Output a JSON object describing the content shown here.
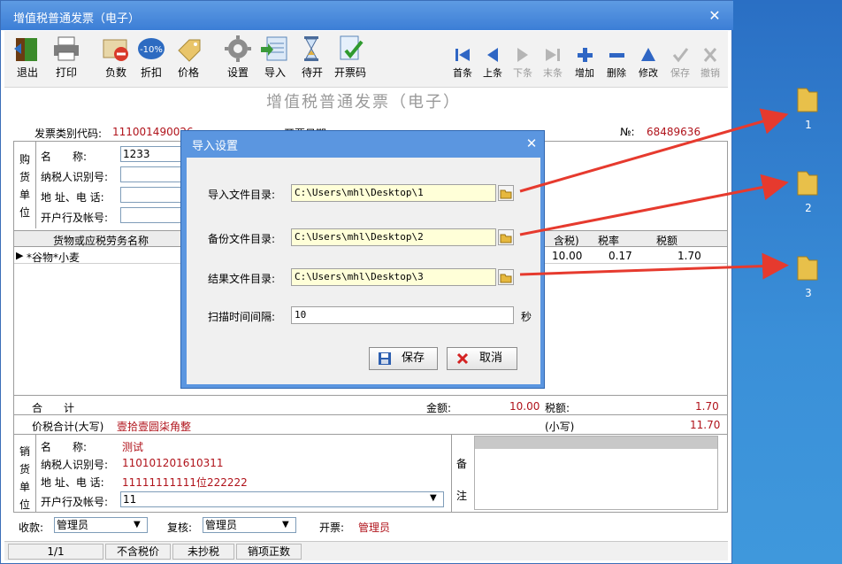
{
  "window": {
    "title": "增值税普通发票（电子）",
    "close": "✕"
  },
  "toolbar": {
    "left": [
      {
        "label": "退出",
        "icon": "exit-icon"
      },
      {
        "label": "打印",
        "icon": "printer-icon"
      },
      {
        "label": "负数",
        "icon": "negative-icon"
      },
      {
        "label": "折扣",
        "icon": "discount-icon"
      },
      {
        "label": "价格",
        "icon": "price-icon"
      },
      {
        "label": "设置",
        "icon": "gear-icon"
      },
      {
        "label": "导入",
        "icon": "import-icon"
      },
      {
        "label": "待开",
        "icon": "hourglass-icon"
      },
      {
        "label": "开票码",
        "icon": "invoice-code-icon"
      }
    ],
    "discount_badge": "-10%",
    "nav": [
      {
        "label": "首条",
        "icon": "first-icon"
      },
      {
        "label": "上条",
        "icon": "prev-icon"
      },
      {
        "label": "下条",
        "icon": "next-icon"
      },
      {
        "label": "末条",
        "icon": "last-icon"
      },
      {
        "label": "增加",
        "icon": "add-icon"
      },
      {
        "label": "删除",
        "icon": "delete-icon"
      },
      {
        "label": "修改",
        "icon": "edit-icon"
      },
      {
        "label": "保存",
        "icon": "save-check-icon"
      },
      {
        "label": "撤销",
        "icon": "undo-icon"
      }
    ]
  },
  "invoice": {
    "heading": "增值税普通发票（电子）",
    "code_label": "发票类别代码:",
    "code_value": "111001490026",
    "date_label": "开票日期:",
    "no_label": "№:",
    "no_value": "68489636",
    "buyer": {
      "side_label": [
        "购",
        "货",
        "单",
        "位"
      ],
      "name_label": "名　　称:",
      "name_value": "1233",
      "taxid_label": "纳税人识别号:",
      "addr_label": "地 址、电 话:",
      "bank_label": "开户行及帐号:"
    },
    "grid": {
      "headers": [
        "货物或应税劳务名称",
        "含税)",
        "税率",
        "税额"
      ],
      "row": {
        "name": "*谷物*小麦",
        "amount": "10.00",
        "rate": "0.17",
        "tax": "1.70"
      }
    },
    "total": {
      "label_left": "合　　计",
      "amount_label": "金额:",
      "amount": "10.00",
      "tax_label": "税额:",
      "tax": "1.70",
      "words_label": "价税合计(大写)",
      "words": "壹拾壹圆柒角整",
      "small_label": "(小写)",
      "small": "11.70"
    },
    "seller": {
      "side_label": [
        "销",
        "货",
        "单",
        "位"
      ],
      "name_label": "名　　称:",
      "name_value": "测试",
      "taxid_label": "纳税人识别号:",
      "taxid_value": "110101201610311",
      "addr_label": "地 址、电 话:",
      "addr_value": "11111111111位222222",
      "bank_label": "开户行及帐号:",
      "bank_value": "11",
      "remark_label": [
        "备",
        "注"
      ]
    },
    "footer": {
      "payee_label": "收款:",
      "payee": "管理员",
      "review_label": "复核:",
      "review": "管理员",
      "issuer_label": "开票:",
      "issuer": "管理员"
    }
  },
  "status": [
    "1/1",
    "不含税价",
    "未抄税",
    "销项正数"
  ],
  "dialog": {
    "title": "导入设置",
    "close": "✕",
    "import_label": "导入文件目录:",
    "import_value": "C:\\Users\\mhl\\Desktop\\1",
    "backup_label": "备份文件目录:",
    "backup_value": "C:\\Users\\mhl\\Desktop\\2",
    "result_label": "结果文件目录:",
    "result_value": "C:\\Users\\mhl\\Desktop\\3",
    "interval_label": "扫描时间间隔:",
    "interval_value": "10",
    "interval_unit": "秒",
    "save_label": "保存",
    "cancel_label": "取消"
  },
  "desktop": {
    "folders": [
      {
        "label": "1"
      },
      {
        "label": "2"
      },
      {
        "label": "3"
      }
    ]
  },
  "colors": {
    "title_bar": "#3c7ed6",
    "arrow": "#e63a2e",
    "red_text": "#b0131b"
  }
}
